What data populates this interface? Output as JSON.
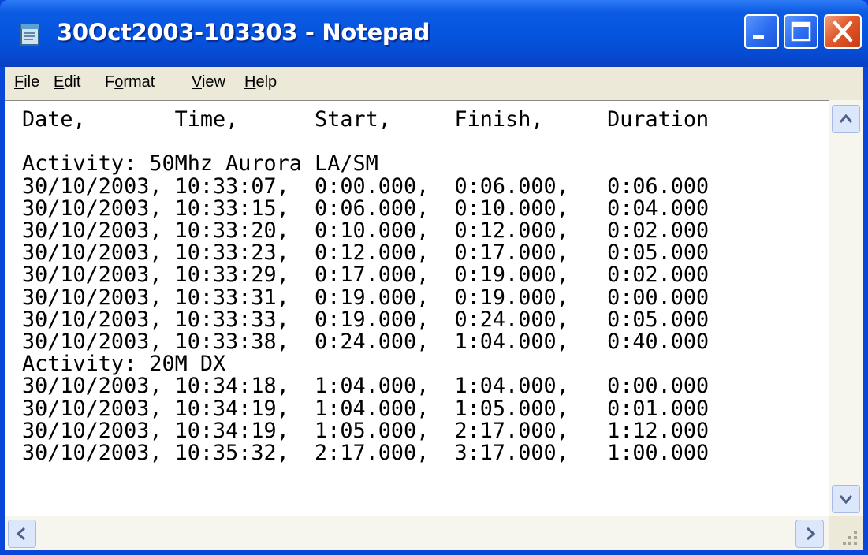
{
  "window": {
    "title": "30Oct2003-103303 - Notepad",
    "colors": {
      "titlebar": "#0654de",
      "close": "#e15a2c",
      "chrome": "#ece9d8"
    }
  },
  "icons": [
    "notepad-icon",
    "minimize-icon",
    "maximize-icon",
    "close-icon",
    "scroll-up-icon",
    "scroll-down-icon",
    "scroll-left-icon",
    "scroll-right-icon",
    "size-grip-icon"
  ],
  "menu": {
    "file": {
      "acc": "F",
      "rest": "ile"
    },
    "edit": {
      "acc": "E",
      "rest": "dit"
    },
    "format": {
      "pre": "F",
      "acc": "o",
      "rest": "rmat"
    },
    "view": {
      "acc": "V",
      "rest": "iew"
    },
    "help": {
      "acc": "H",
      "rest": "elp"
    }
  },
  "document": {
    "text": "Date,       Time,      Start,     Finish,     Duration\n\nActivity: 50Mhz Aurora LA/SM\n30/10/2003, 10:33:07,  0:00.000,  0:06.000,   0:06.000\n30/10/2003, 10:33:15,  0:06.000,  0:10.000,   0:04.000\n30/10/2003, 10:33:20,  0:10.000,  0:12.000,   0:02.000\n30/10/2003, 10:33:23,  0:12.000,  0:17.000,   0:05.000\n30/10/2003, 10:33:29,  0:17.000,  0:19.000,   0:02.000\n30/10/2003, 10:33:31,  0:19.000,  0:19.000,   0:00.000\n30/10/2003, 10:33:33,  0:19.000,  0:24.000,   0:05.000\n30/10/2003, 10:33:38,  0:24.000,  1:04.000,   0:40.000\nActivity: 20M DX\n30/10/2003, 10:34:18,  1:04.000,  1:04.000,   0:00.000\n30/10/2003, 10:34:19,  1:04.000,  1:05.000,   0:01.000\n30/10/2003, 10:34:19,  1:05.000,  2:17.000,   1:12.000\n30/10/2003, 10:35:32,  2:17.000,  3:17.000,   1:00.000"
  }
}
